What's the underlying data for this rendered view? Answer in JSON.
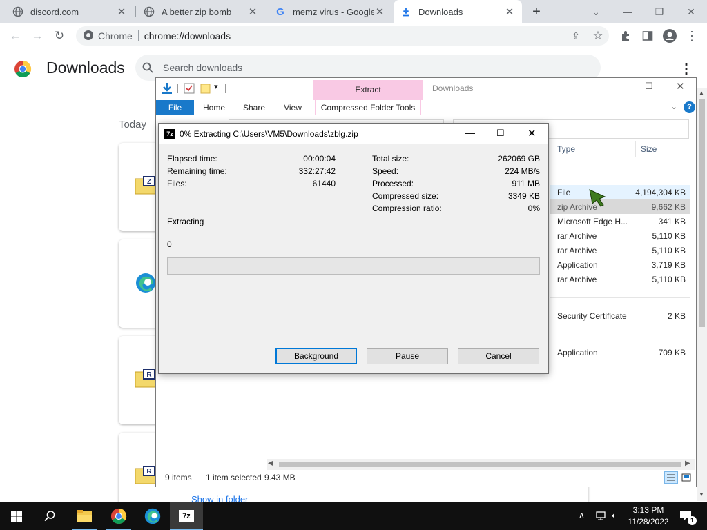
{
  "browser": {
    "tabs": [
      {
        "title": "discord.com",
        "icon": "globe-icon"
      },
      {
        "title": "A better zip bomb",
        "icon": "globe-icon"
      },
      {
        "title": "memz virus - Google Se",
        "icon": "google-icon"
      },
      {
        "title": "Downloads",
        "icon": "download-icon"
      }
    ],
    "omnibox_label": "Chrome",
    "url": "chrome://downloads"
  },
  "downloads_page": {
    "title": "Downloads",
    "search_placeholder": "Search downloads",
    "date_heading": "Today",
    "show_in_folder": "Show in folder"
  },
  "explorer": {
    "window_title": "Downloads",
    "context_tab": "Extract",
    "ribbon_tabs": [
      "File",
      "Home",
      "Share",
      "View",
      "Compressed Folder Tools"
    ],
    "columns": {
      "type": "Type",
      "size": "Size"
    },
    "rows": [
      {
        "type": "File",
        "size": "4,194,304 KB"
      },
      {
        "type": "zip Archive",
        "size": "9,662 KB"
      },
      {
        "type": "Microsoft Edge H...",
        "size": "341 KB"
      },
      {
        "type": "rar Archive",
        "size": "5,110 KB"
      },
      {
        "type": "rar Archive",
        "size": "5,110 KB"
      },
      {
        "type": "Application",
        "size": "3,719 KB"
      },
      {
        "type": "rar Archive",
        "size": "5,110 KB"
      },
      {
        "type": "Security Certificate",
        "size": "2 KB"
      },
      {
        "type": "Application",
        "size": "709 KB"
      }
    ],
    "status": {
      "items": "9 items",
      "selected": "1 item selected",
      "size": "9.43 MB"
    }
  },
  "zip_dialog": {
    "app_badge": "7z",
    "title": "0% Extracting C:\\Users\\VM5\\Downloads\\zblg.zip",
    "left_stats": [
      {
        "label": "Elapsed time:",
        "value": "00:00:04"
      },
      {
        "label": "Remaining time:",
        "value": "332:27:42"
      },
      {
        "label": "Files:",
        "value": "61440"
      }
    ],
    "right_stats": [
      {
        "label": "Total size:",
        "value": "262069 GB"
      },
      {
        "label": "Speed:",
        "value": "224 MB/s"
      },
      {
        "label": "Processed:",
        "value": "911 MB"
      },
      {
        "label": "Compressed size:",
        "value": "3349 KB"
      },
      {
        "label": "Compression ratio:",
        "value": "0%"
      }
    ],
    "operation": "Extracting",
    "current_item": "0",
    "progress": 0,
    "buttons": {
      "background": "Background",
      "pause": "Pause",
      "cancel": "Cancel"
    }
  },
  "taskbar": {
    "time": "3:13 PM",
    "date": "11/28/2022",
    "notification_count": "1",
    "sevenzip_label": "7z"
  },
  "colors": {
    "chrome_tabstrip": "#dee1e6",
    "explorer_file_tab": "#1979ca",
    "extract_tab": "#f9c9e4",
    "selected_row": "#cce8ff",
    "dialog_bg": "#f0f0f0",
    "taskbar": "#101010",
    "link_blue": "#1a73e8"
  }
}
